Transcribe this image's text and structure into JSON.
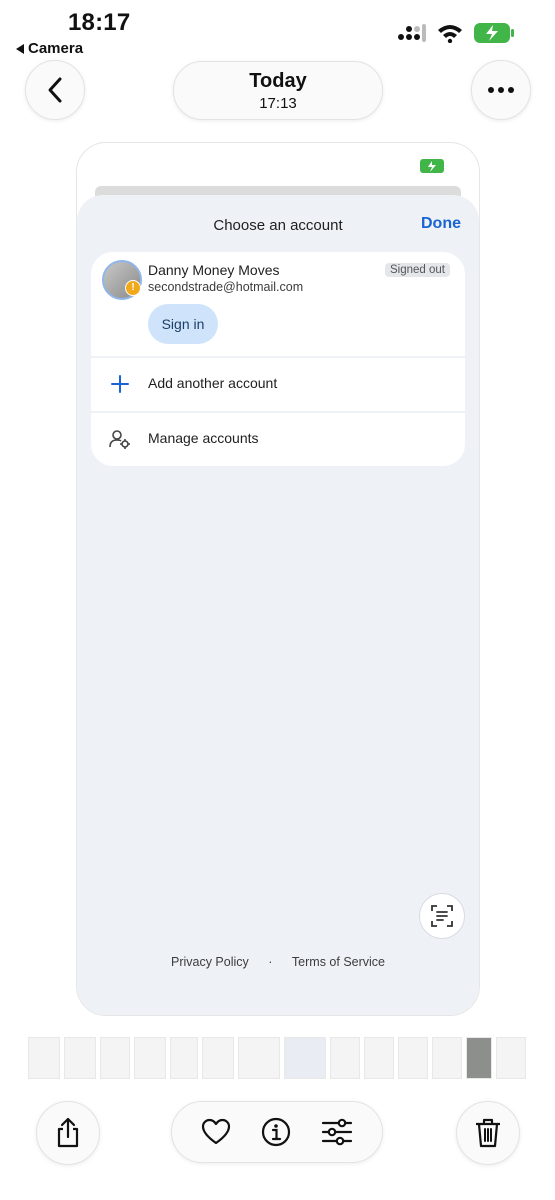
{
  "status_bar": {
    "time": "18:17",
    "back_app_label": "Camera"
  },
  "header": {
    "title": "Today",
    "subtitle": "17:13"
  },
  "icons": {
    "back": "chevron-left-icon",
    "more": "ellipsis-icon",
    "share": "share-icon",
    "favorite": "heart-icon",
    "info": "info-icon",
    "adjust": "sliders-icon",
    "delete": "trash-icon"
  },
  "screenshot": {
    "sheet_title": "Choose an account",
    "done_label": "Done",
    "account": {
      "name": "Danny Money Moves",
      "email": "secondstrade@hotmail.com",
      "status": "Signed out",
      "sign_in_label": "Sign in"
    },
    "add_account_label": "Add another account",
    "manage_accounts_label": "Manage accounts",
    "footer": {
      "privacy": "Privacy Policy",
      "separator": "·",
      "terms": "Terms of Service"
    }
  },
  "colors": {
    "accent": "#1a64d1",
    "sheet_bg": "#eef2f7",
    "sign_in_bg": "#cfe4fb",
    "battery": "#42b549",
    "warning": "#f1a91b"
  }
}
